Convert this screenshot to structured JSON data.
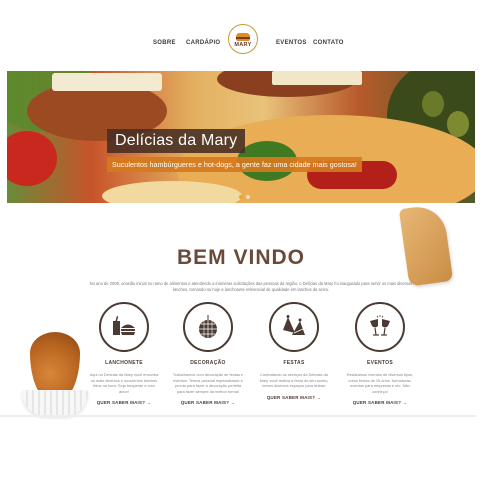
{
  "nav": {
    "items": [
      {
        "label": "SOBRE"
      },
      {
        "label": "CARDÁPIO"
      },
      {
        "label": "EVENTOS"
      },
      {
        "label": "CONTATO"
      }
    ],
    "logo_text": "MARY"
  },
  "hero": {
    "title": "Delícias da Mary",
    "subtitle": "Suculentos hambúrgueres e hot-dogs, a gente faz uma cidade mais gostosa!",
    "slides": 2,
    "active_slide": 1
  },
  "welcome": {
    "heading": "BEM VINDO",
    "intro": "No ano de 2009, ocasião inicial no ramo de alimentos e atendendo a inúmeras solicitações das pessoas da região, o Delícias da Mary foi inaugurado para servir os mais diversos lanches, tornando-se hoje a lanchonete referencial de qualidade em lanches da serra."
  },
  "features": [
    {
      "icon": "drink-burger-icon",
      "title": "LANCHONETE",
      "desc": "Aqui no Delícias da Mary você encontra os mais diversos e suculentos lanches fritos na hora. Seja frequente e com amor!",
      "link": "QUER SABER MAIS? →"
    },
    {
      "icon": "disco-ball-icon",
      "title": "DECORAÇÃO",
      "desc": "Trabalhamos com decoração de festas e eventos. Temos pessoal especializado e pronto para fazer a decoração perfeita para fazer sempre da melhor forma!",
      "link": "QUER SABER MAIS? →"
    },
    {
      "icon": "party-hat-icon",
      "title": "FESTAS",
      "desc": "Contratando os serviços da Delícias da Mary você realiza a festa do seu sonho, temos diversos espaços para festas!",
      "link": "QUER SABER MAIS? →"
    },
    {
      "icon": "toast-glasses-icon",
      "title": "EVENTOS",
      "desc": "Realizamos eventos de diversos tipos, como festas de 15 anos, formaturas, eventos para empresas e etc. Não conheço!",
      "link": "QUER SABER MAIS? →"
    }
  ],
  "colors": {
    "accent": "#d47a1c",
    "brown": "#6b4a3a",
    "dark": "#4a3a33"
  }
}
